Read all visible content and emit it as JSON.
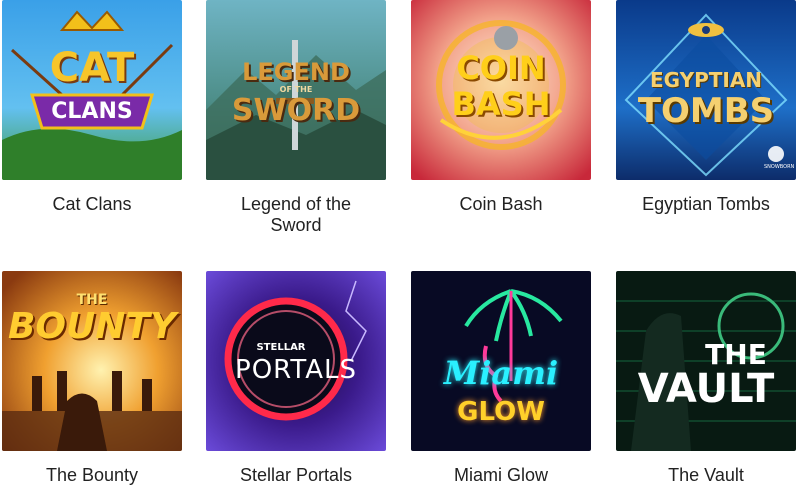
{
  "games": [
    {
      "title": "Cat Clans",
      "logo_line1": "CAT",
      "logo_line2": "CLANS",
      "icon": "cat-clans-art"
    },
    {
      "title": "Legend of the Sword",
      "logo_line1": "LEGEND",
      "logo_small": "OF THE",
      "logo_line2": "SWORD",
      "icon": "legend-sword-art"
    },
    {
      "title": "Coin Bash",
      "logo_line1": "COIN",
      "logo_line2": "BASH",
      "icon": "coin-bash-art"
    },
    {
      "title": "Egyptian Tombs",
      "logo_line1": "EGYPTIAN",
      "logo_line2": "TOMBS",
      "badge": "SNOWBORN",
      "icon": "egyptian-tombs-art"
    },
    {
      "title": "The Bounty",
      "logo_small": "THE",
      "logo_line1": "BOUNTY",
      "icon": "the-bounty-art"
    },
    {
      "title": "Stellar Portals",
      "logo_small": "STELLAR",
      "logo_line1": "PORTALS",
      "icon": "stellar-portals-art"
    },
    {
      "title": "Miami Glow",
      "logo_line1": "Miami",
      "logo_line2": "GLOW",
      "icon": "miami-glow-art"
    },
    {
      "title": "The Vault",
      "logo_line1": "THE",
      "logo_line2": "VAULT",
      "icon": "the-vault-art"
    }
  ]
}
